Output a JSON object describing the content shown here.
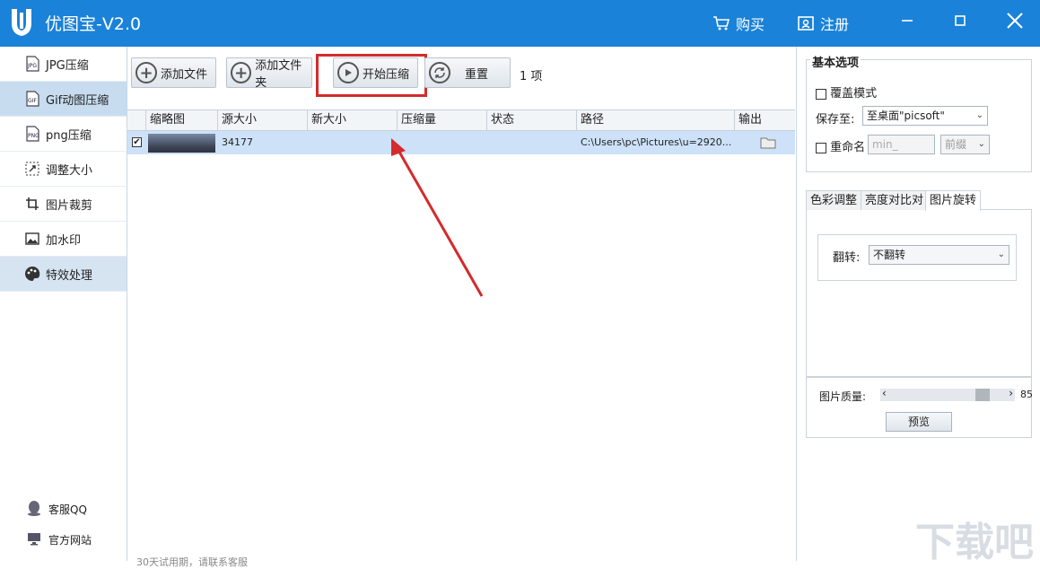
{
  "window": {
    "title": "优图宝-V2.0",
    "buy_label": "购买",
    "register_label": "注册"
  },
  "sidebar": {
    "items": [
      {
        "label": "JPG压缩",
        "icon": "jpg-file-icon"
      },
      {
        "label": "Gif动图压缩",
        "icon": "gif-file-icon"
      },
      {
        "label": "png压缩",
        "icon": "png-file-icon"
      },
      {
        "label": "调整大小",
        "icon": "resize-icon"
      },
      {
        "label": "图片裁剪",
        "icon": "crop-icon"
      },
      {
        "label": "加水印",
        "icon": "image-icon"
      },
      {
        "label": "特效处理",
        "icon": "palette-icon"
      }
    ],
    "bottom": [
      {
        "label": "客服QQ",
        "icon": "qq-penguin-icon"
      },
      {
        "label": "官方网站",
        "icon": "monitor-icon"
      }
    ]
  },
  "toolbar": {
    "add_file": "添加文件",
    "add_folder": "添加文件夹",
    "start": "开始压缩",
    "reset": "重置",
    "count": "1 项"
  },
  "table": {
    "columns": [
      "缩略图",
      "源大小",
      "新大小",
      "压缩量",
      "状态",
      "路径",
      "输出"
    ],
    "rows": [
      {
        "checked": true,
        "source_size": "34177",
        "new_size": "",
        "reduction": "",
        "status": "",
        "path": "C:\\Users\\pc\\Pictures\\u=2920..."
      }
    ]
  },
  "footer_text": "30天试用期，请联系客服",
  "right_panel": {
    "basic_title": "基本选项",
    "overwrite_label": "覆盖模式",
    "save_to_label": "保存至:",
    "save_to_value": "至桌面\"picsoft\"",
    "rename_label": "重命名",
    "rename_placeholder": "min_",
    "prefix_value": "前缀",
    "tabs": [
      "色彩调整",
      "亮度对比对",
      "图片旋转"
    ],
    "flip_label": "翻转:",
    "flip_value": "不翻转",
    "quality_label": "图片质量:",
    "quality_value": "85",
    "quality_fraction": 0.85,
    "preview_label": "预览"
  },
  "watermark": "下载吧"
}
